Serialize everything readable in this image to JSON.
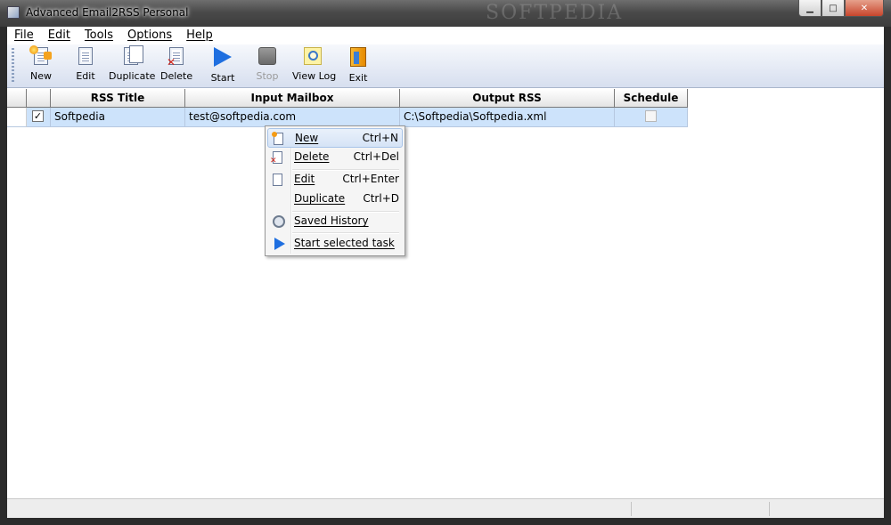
{
  "window": {
    "title": "Advanced Email2RSS Personal",
    "watermark": "SOFTPEDIA",
    "controls": {
      "minimize": "▁",
      "maximize": "□",
      "close": "✕"
    }
  },
  "menubar": {
    "items": [
      {
        "label": "File"
      },
      {
        "label": "Edit"
      },
      {
        "label": "Tools"
      },
      {
        "label": "Options"
      },
      {
        "label": "Help"
      }
    ]
  },
  "toolbar": {
    "new_label": "New",
    "edit_label": "Edit",
    "duplicate_label": "Duplicate",
    "delete_label": "Delete",
    "start_label": "Start",
    "stop_label": "Stop",
    "viewlog_label": "View Log",
    "exit_label": "Exit",
    "stop_enabled": false
  },
  "grid": {
    "columns": [
      "",
      "RSS Title",
      "Input Mailbox",
      "Output RSS",
      "Schedule"
    ],
    "rows": [
      {
        "enabled_mark": "✓",
        "rss_title": "Softpedia",
        "input_mailbox": "test@softpedia.com",
        "output_rss": "C:\\Softpedia\\Softpedia.xml",
        "schedule_checked": false
      }
    ],
    "selected_row_color": "#cde3fb"
  },
  "context_menu": {
    "items": [
      {
        "label": "New",
        "shortcut": "Ctrl+N",
        "icon": "new-doc-icon"
      },
      {
        "label": "Delete",
        "shortcut": "Ctrl+Del",
        "icon": "delete-doc-icon"
      },
      {
        "label": "Edit",
        "shortcut": "Ctrl+Enter",
        "icon": "edit-doc-icon"
      },
      {
        "label": "Duplicate",
        "shortcut": "Ctrl+D",
        "icon": ""
      },
      {
        "label": "Saved History",
        "shortcut": "",
        "icon": "history-icon"
      },
      {
        "label": "Start selected task",
        "shortcut": "",
        "icon": "start-icon"
      }
    ]
  },
  "colors": {
    "accent_blue": "#1f6fe0",
    "selection": "#cde3fb"
  }
}
